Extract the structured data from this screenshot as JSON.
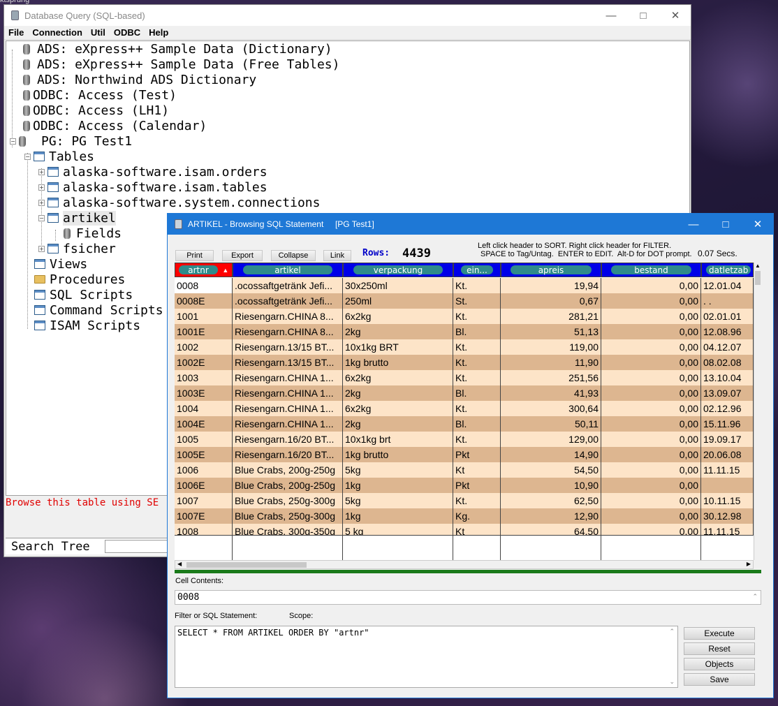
{
  "desktop": {
    "corner_text": "ktsprung"
  },
  "main_window": {
    "title": "Database Query (SQL-based)",
    "menu": [
      "File",
      "Connection",
      "Util",
      "ODBC",
      "Help"
    ],
    "tree": [
      {
        "label": "ADS: eXpress++ Sample Data (Dictionary)",
        "type": "db"
      },
      {
        "label": "ADS: eXpress++ Sample Data (Free Tables)",
        "type": "db"
      },
      {
        "label": "ADS: Northwind ADS Dictionary",
        "type": "db"
      },
      {
        "label": "ODBC: Access (Test)",
        "type": "db"
      },
      {
        "label": "ODBC: Access (LH1)",
        "type": "db"
      },
      {
        "label": "ODBC: Access (Calendar)",
        "type": "db"
      },
      {
        "label": "PG: PG Test1",
        "type": "db"
      },
      {
        "label": "Tables",
        "type": "table"
      },
      {
        "label": "alaska-software.isam.orders",
        "type": "table"
      },
      {
        "label": "alaska-software.isam.tables",
        "type": "table"
      },
      {
        "label": "alaska-software.system.connections",
        "type": "table"
      },
      {
        "label": "artikel",
        "type": "table"
      },
      {
        "label": "Fields",
        "type": "db"
      },
      {
        "label": "fsicher",
        "type": "table"
      },
      {
        "label": "Views",
        "type": "table"
      },
      {
        "label": "Procedures",
        "type": "folder"
      },
      {
        "label": "SQL Scripts",
        "type": "table"
      },
      {
        "label": "Command Scripts",
        "type": "table"
      },
      {
        "label": "ISAM Scripts",
        "type": "table"
      }
    ],
    "status_text": "Browse this table using SE",
    "search_label": "Search Tree"
  },
  "browse_window": {
    "title": "ARTIKEL - Browsing SQL Statement     [PG Test1]",
    "toolbar": {
      "print": "Print",
      "export": "Export",
      "collapse": "Collapse",
      "link": "Link",
      "rows_label": "Rows:",
      "rows_value": "4439"
    },
    "hint1": "Left click header to SORT. Right click header for FILTER.",
    "hint2": "SPACE to Tag/Untag.  ENTER to EDIT.  Alt-D for DOT prompt.",
    "timing": "0.07 Secs.",
    "columns": [
      "artnr",
      "artikel",
      "verpackung",
      "ein...",
      "apreis",
      "bestand",
      "datletzab"
    ],
    "rows": [
      [
        "0008",
        ".ocossaftgetränk Jefi...",
        "30x250ml",
        "Kt.",
        "19,94",
        "0,00",
        "12.01.04"
      ],
      [
        "0008E",
        ".ocossaftgetränk Jefi...",
        "250ml",
        "St.",
        "0,67",
        "0,00",
        ". ."
      ],
      [
        "1001",
        "Riesengarn.CHINA  8...",
        "6x2kg",
        "Kt.",
        "281,21",
        "0,00",
        "02.01.01"
      ],
      [
        "1001E",
        "Riesengarn.CHINA  8...",
        "2kg",
        "Bl.",
        "51,13",
        "0,00",
        "12.08.96"
      ],
      [
        "1002",
        "Riesengarn.13/15 BT...",
        "10x1kg BRT",
        "Kt.",
        "119,00",
        "0,00",
        "04.12.07"
      ],
      [
        "1002E",
        "Riesengarn.13/15 BT...",
        "1kg brutto",
        "Kt.",
        "11,90",
        "0,00",
        "08.02.08"
      ],
      [
        "1003",
        "Riesengarn.CHINA 1...",
        "6x2kg",
        "Kt.",
        "251,56",
        "0,00",
        "13.10.04"
      ],
      [
        "1003E",
        "Riesengarn.CHINA 1...",
        "2kg",
        "Bl.",
        "41,93",
        "0,00",
        "13.09.07"
      ],
      [
        "1004",
        "Riesengarn.CHINA 1...",
        "6x2kg",
        "Kt.",
        "300,64",
        "0,00",
        "02.12.96"
      ],
      [
        "1004E",
        "Riesengarn.CHINA 1...",
        "2kg",
        "Bl.",
        "50,11",
        "0,00",
        "15.11.96"
      ],
      [
        "1005",
        "Riesengarn.16/20 BT...",
        "10x1kg brt",
        "Kt.",
        "129,00",
        "0,00",
        "19.09.17"
      ],
      [
        "1005E",
        "Riesengarn.16/20 BT...",
        "1kg brutto",
        "Pkt",
        "14,90",
        "0,00",
        "20.06.08"
      ],
      [
        "1006",
        "Blue Crabs, 200g-250g",
        "5kg",
        "Kt",
        "54,50",
        "0,00",
        "11.11.15"
      ],
      [
        "1006E",
        "Blue Crabs, 200g-250g",
        "1kg",
        "Pkt",
        "10,90",
        "0,00",
        ""
      ],
      [
        "1007",
        "Blue Crabs, 250g-300g",
        "5kg",
        "Kt.",
        "62,50",
        "0,00",
        "10.11.15"
      ],
      [
        "1007E",
        "Blue Crabs, 250g-300g",
        "1kg",
        "Kg.",
        "12,90",
        "0,00",
        "30.12.98"
      ],
      [
        "1008",
        "Blue Crabs, 300g-350g",
        "5 kg",
        "Kt",
        "64,50",
        "0,00",
        "11.11.15"
      ]
    ],
    "cell_contents_label": "Cell Contents:",
    "cell_contents_value": "0008",
    "filter_label": "Filter or SQL Statement:",
    "scope_label": "Scope:",
    "sql": "SELECT * FROM ARTIKEL ORDER BY \"artnr\"",
    "buttons": {
      "execute": "Execute",
      "reset": "Reset",
      "objects": "Objects",
      "save": "Save"
    },
    "colors": {
      "header_blue": "#0000e8",
      "sort_header": "#ff0000",
      "row_light": "#fde4c8",
      "row_dark": "#ddb690",
      "pill": "#2e8b8b",
      "divider_green": "#1a7a1a"
    }
  }
}
